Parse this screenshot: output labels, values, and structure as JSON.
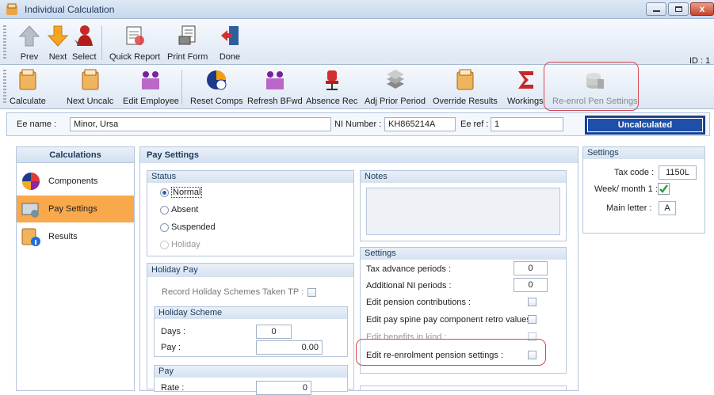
{
  "window": {
    "title": "Individual Calculation",
    "close": "x"
  },
  "toolbar1": {
    "prev": "Prev",
    "next": "Next",
    "select": "Select",
    "quick_report": "Quick Report",
    "print_form": "Print Form",
    "done": "Done",
    "id_label": "ID : 1"
  },
  "toolbar2": {
    "calculate": "Calculate",
    "next_uncalc": "Next Uncalc",
    "edit_employee": "Edit Employee",
    "reset_comps": "Reset Comps",
    "refresh_bfwd": "Refresh BFwd",
    "absence_rec": "Absence Rec",
    "adj_prior_period": "Adj Prior Period",
    "override_results": "Override Results",
    "workings": "Workings",
    "reenrol_pen_settings": "Re-enrol Pen Settings"
  },
  "employee": {
    "name_label": "Ee name :",
    "name": "Minor, Ursa",
    "ni_label": "NI Number :",
    "ni": "KH865214A",
    "ref_label": "Ee ref :",
    "ref": "1",
    "status": "Uncalculated"
  },
  "left": {
    "header": "Calculations",
    "items": [
      "Components",
      "Pay Settings",
      "Results"
    ]
  },
  "main": {
    "header": "Pay Settings",
    "status": {
      "title": "Status",
      "options": [
        "Normal",
        "Absent",
        "Suspended",
        "Holiday"
      ],
      "selected": "Normal"
    },
    "notes": {
      "title": "Notes"
    },
    "holiday_pay": {
      "title": "Holiday Pay",
      "record_label": "Record Holiday Schemes Taken TP :"
    },
    "holiday_scheme": {
      "title": "Holiday Scheme",
      "days_label": "Days :",
      "days": "0",
      "pay_label": "Pay :",
      "pay": "0.00"
    },
    "pay": {
      "title": "Pay",
      "rate_label": "Rate :",
      "rate": "0"
    },
    "settings": {
      "title": "Settings",
      "tax_adv_label": "Tax advance periods :",
      "tax_adv": "0",
      "add_ni_label": "Additional NI periods :",
      "add_ni": "0",
      "edit_pension": "Edit pension contributions :",
      "edit_spine": "Edit pay spine pay component retro values :",
      "edit_bik": "Edit benefits in kind :",
      "edit_reenrol": "Edit re-enrolment pension settings :"
    }
  },
  "right": {
    "title": "Settings",
    "tax_code_label": "Tax code :",
    "tax_code": "1150L",
    "week1_label": "Week/ month 1 :",
    "week1_checked": true,
    "main_letter_label": "Main letter :",
    "main_letter": "A"
  },
  "colors": {
    "accent": "#1f4fa8",
    "selected": "#f9a84c",
    "highlight": "#d9464f"
  }
}
